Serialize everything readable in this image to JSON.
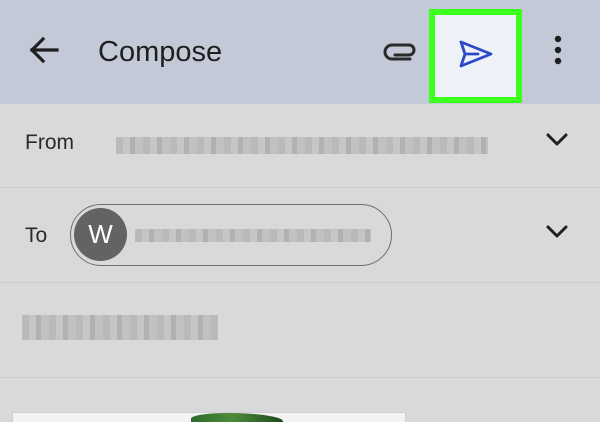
{
  "header": {
    "title": "Compose",
    "back_icon": "arrow-left-icon",
    "attach_icon": "paperclip-icon",
    "send_icon": "send-icon",
    "more_icon": "more-vertical-icon",
    "highlight_color": "#3bff1c",
    "send_color": "#2a49c8"
  },
  "from_row": {
    "label": "From",
    "expand_icon": "chevron-down-icon"
  },
  "to_row": {
    "label": "To",
    "recipient_initial": "W",
    "expand_icon": "chevron-down-icon"
  },
  "colors": {
    "appbar": "#c3c9d6",
    "background": "#d8d9da",
    "avatar": "#636363"
  }
}
